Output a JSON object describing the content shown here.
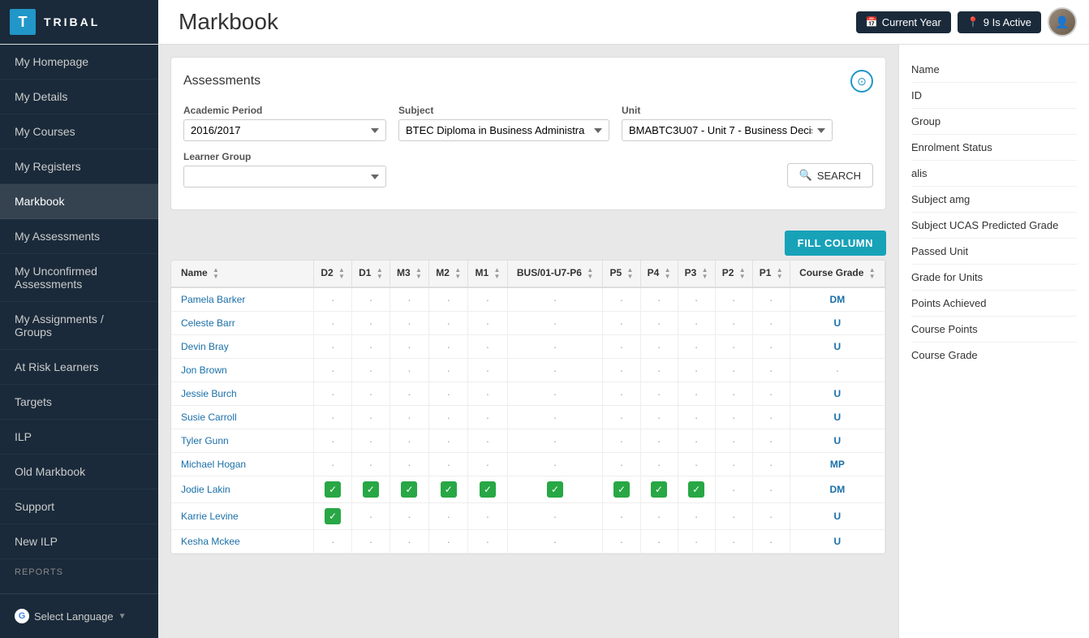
{
  "header": {
    "logo_letter": "T",
    "logo_text": "TRIBAL",
    "page_title": "Markbook",
    "btn_current_year": "Current Year",
    "btn_is_active": "9 Is Active"
  },
  "sidebar": {
    "items": [
      {
        "label": "My Homepage",
        "active": false
      },
      {
        "label": "My Details",
        "active": false
      },
      {
        "label": "My Courses",
        "active": false
      },
      {
        "label": "My Registers",
        "active": false
      },
      {
        "label": "Markbook",
        "active": true
      },
      {
        "label": "My Assessments",
        "active": false
      },
      {
        "label": "My Unconfirmed Assessments",
        "active": false
      },
      {
        "label": "My Assignments / Groups",
        "active": false
      },
      {
        "label": "At Risk Learners",
        "active": false
      },
      {
        "label": "Targets",
        "active": false
      },
      {
        "label": "ILP",
        "active": false
      },
      {
        "label": "Old Markbook",
        "active": false
      },
      {
        "label": "Support",
        "active": false
      },
      {
        "label": "New ILP",
        "active": false
      }
    ],
    "reports_label": "REPORTS",
    "select_language": "Select Language"
  },
  "assessments_panel": {
    "title": "Assessments",
    "academic_period_label": "Academic Period",
    "academic_period_value": "2016/2017",
    "subject_label": "Subject",
    "subject_value": "BTEC Diploma in Business Administra",
    "unit_label": "Unit",
    "unit_value": "BMABTC3U07 - Unit 7 - Business Decis",
    "learner_group_label": "Learner Group",
    "learner_group_value": "",
    "search_btn": "SEARCH"
  },
  "table": {
    "fill_column_btn": "FILL COLUMN",
    "columns": [
      "Name",
      "D2",
      "D1",
      "M3",
      "M2",
      "M1",
      "BUS/01-U7-P6",
      "P5",
      "P4",
      "P3",
      "P2",
      "P1",
      "Course Grade"
    ],
    "rows": [
      {
        "name": "Pamela Barker",
        "cells": [
          "·",
          "·",
          "·",
          "·",
          "·",
          "·",
          "·",
          "·",
          "·",
          "·",
          "·"
        ],
        "grade": "DM"
      },
      {
        "name": "Celeste Barr",
        "cells": [
          "·",
          "·",
          "·",
          "·",
          "·",
          "·",
          "·",
          "·",
          "·",
          "·",
          "·"
        ],
        "grade": "U"
      },
      {
        "name": "Devin Bray",
        "cells": [
          "·",
          "·",
          "·",
          "·",
          "·",
          "·",
          "·",
          "·",
          "·",
          "·",
          "·"
        ],
        "grade": "U"
      },
      {
        "name": "Jon Brown",
        "cells": [
          "·",
          "·",
          "·",
          "·",
          "·",
          "·",
          "·",
          "·",
          "·",
          "·",
          "·"
        ],
        "grade": ""
      },
      {
        "name": "Jessie Burch",
        "cells": [
          "·",
          "·",
          "·",
          "·",
          "·",
          "·",
          "·",
          "·",
          "·",
          "·",
          "·"
        ],
        "grade": "U"
      },
      {
        "name": "Susie Carroll",
        "cells": [
          "·",
          "·",
          "·",
          "·",
          "·",
          "·",
          "·",
          "·",
          "·",
          "·",
          "·"
        ],
        "grade": "U"
      },
      {
        "name": "Tyler Gunn",
        "cells": [
          "·",
          "·",
          "·",
          "·",
          "·",
          "·",
          "·",
          "·",
          "·",
          "·",
          "·"
        ],
        "grade": "U"
      },
      {
        "name": "Michael Hogan",
        "cells": [
          "·",
          "·",
          "·",
          "·",
          "·",
          "·",
          "·",
          "·",
          "·",
          "·",
          "·"
        ],
        "grade": "MP"
      },
      {
        "name": "Jodie Lakin",
        "cells": [
          "✓",
          "✓",
          "✓",
          "✓",
          "✓",
          "✓",
          "✓",
          "✓",
          "✓",
          "·",
          "·"
        ],
        "grade": "DM",
        "checks": [
          0,
          1,
          2,
          3,
          4,
          5,
          6,
          7,
          8
        ]
      },
      {
        "name": "Karrie Levine",
        "cells": [
          "✓",
          "·",
          "·",
          "·",
          "·",
          "·",
          "·",
          "·",
          "·",
          "·",
          "·"
        ],
        "grade": "U",
        "checks": [
          0
        ]
      },
      {
        "name": "Kesha Mckee",
        "cells": [
          "·",
          "·",
          "·",
          "·",
          "·",
          "·",
          "·",
          "·",
          "·",
          "·",
          "·"
        ],
        "grade": "U"
      }
    ]
  },
  "right_panel": {
    "items": [
      "Name",
      "ID",
      "Group",
      "Enrolment Status",
      "alis",
      "Subject amg",
      "Subject UCAS Predicted Grade",
      "Passed Unit",
      "Grade for Units",
      "Points Achieved",
      "Course Points",
      "Course Grade"
    ]
  }
}
